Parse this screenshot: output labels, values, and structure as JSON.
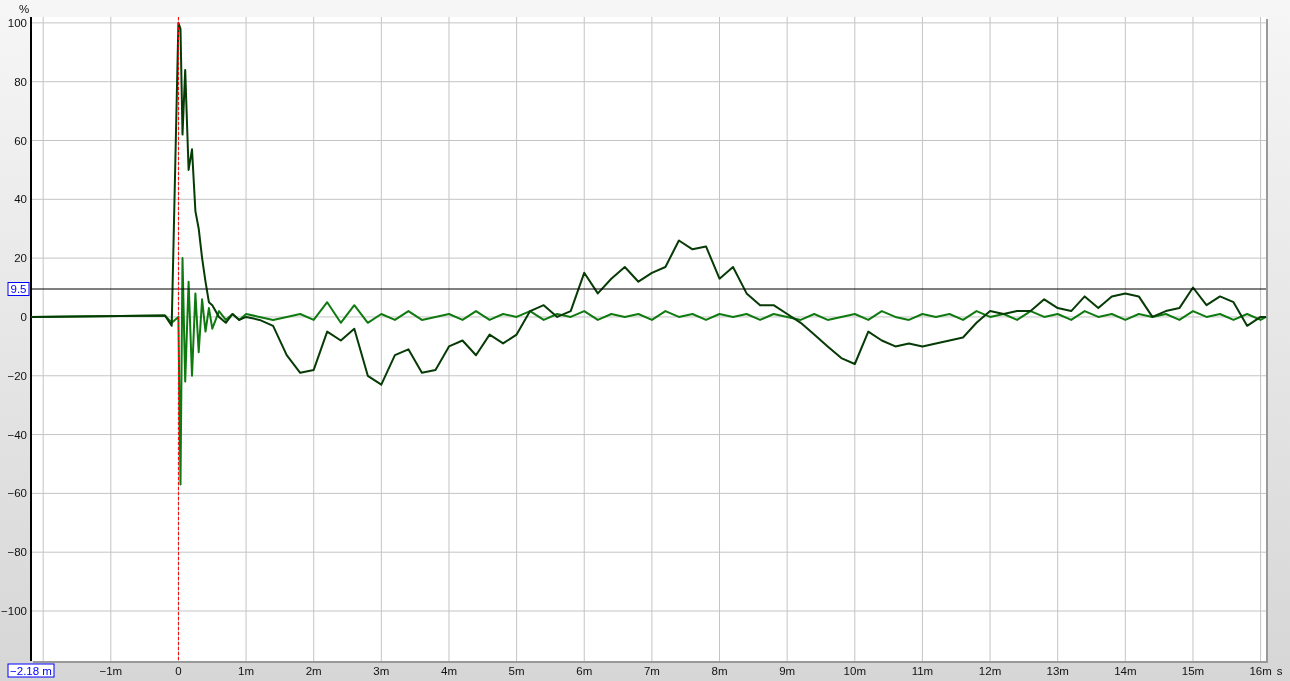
{
  "chart_data": {
    "type": "line",
    "ylabel": "%",
    "xlabel": "s",
    "xlim": [
      -2.18,
      16.08
    ],
    "ylim": [
      -117,
      102
    ],
    "yticks": [
      {
        "value": 100,
        "label": "100"
      },
      {
        "value": 80,
        "label": "80"
      },
      {
        "value": 60,
        "label": "60"
      },
      {
        "value": 40,
        "label": "40"
      },
      {
        "value": 20,
        "label": "20"
      },
      {
        "value": 0,
        "label": "0"
      },
      {
        "value": -20,
        "label": "−20"
      },
      {
        "value": -40,
        "label": "−40"
      },
      {
        "value": -60,
        "label": "−60"
      },
      {
        "value": -80,
        "label": "−80"
      },
      {
        "value": -100,
        "label": "−100"
      }
    ],
    "xticks": [
      {
        "value": -1,
        "label": "−1m"
      },
      {
        "value": 0,
        "label": "0"
      },
      {
        "value": 1,
        "label": "1m"
      },
      {
        "value": 2,
        "label": "2m"
      },
      {
        "value": 3,
        "label": "3m"
      },
      {
        "value": 4,
        "label": "4m"
      },
      {
        "value": 5,
        "label": "5m"
      },
      {
        "value": 6,
        "label": "6m"
      },
      {
        "value": 7,
        "label": "7m"
      },
      {
        "value": 8,
        "label": "8m"
      },
      {
        "value": 9,
        "label": "9m"
      },
      {
        "value": 10,
        "label": "10m"
      },
      {
        "value": 11,
        "label": "11m"
      },
      {
        "value": 12,
        "label": "12m"
      },
      {
        "value": 13,
        "label": "13m"
      },
      {
        "value": 14,
        "label": "14m"
      },
      {
        "value": 15,
        "label": "15m"
      },
      {
        "value": 16,
        "label": "16m"
      }
    ],
    "grid": true,
    "x": [
      -2.18,
      -0.2,
      -0.1,
      0,
      0.03,
      0.06,
      0.1,
      0.15,
      0.2,
      0.25,
      0.3,
      0.35,
      0.4,
      0.45,
      0.5,
      0.6,
      0.7,
      0.8,
      0.9,
      1.0,
      1.2,
      1.4,
      1.6,
      1.8,
      2.0,
      2.2,
      2.4,
      2.6,
      2.8,
      3.0,
      3.2,
      3.4,
      3.6,
      3.8,
      4.0,
      4.2,
      4.4,
      4.6,
      4.8,
      5.0,
      5.2,
      5.4,
      5.6,
      5.8,
      6.0,
      6.2,
      6.4,
      6.6,
      6.8,
      7.0,
      7.2,
      7.4,
      7.6,
      7.8,
      8.0,
      8.2,
      8.4,
      8.6,
      8.8,
      9.0,
      9.2,
      9.4,
      9.6,
      9.8,
      10.0,
      10.2,
      10.4,
      10.6,
      10.8,
      11.0,
      11.2,
      11.4,
      11.6,
      11.8,
      12.0,
      12.2,
      12.4,
      12.6,
      12.8,
      13.0,
      13.2,
      13.4,
      13.6,
      13.8,
      14.0,
      14.2,
      14.4,
      14.6,
      14.8,
      15.0,
      15.2,
      15.4,
      15.6,
      15.8,
      16.0,
      16.08
    ],
    "series": [
      {
        "color": "#0f7a0f",
        "values": [
          0,
          0.5,
          -2,
          0,
          -57,
          20,
          -22,
          12,
          -20,
          8,
          -12,
          6,
          -5,
          3,
          -4,
          2,
          -1,
          1,
          -1,
          1,
          0,
          -1,
          0,
          1,
          -1,
          5,
          -2,
          4,
          -2,
          1,
          -1,
          2,
          -1,
          0,
          1,
          -1,
          2,
          -1,
          1,
          0,
          2,
          -1,
          1,
          0,
          2,
          -1,
          1,
          0,
          1,
          -1,
          2,
          0,
          1,
          -1,
          1,
          0,
          1,
          -1,
          1,
          0,
          -1,
          1,
          -1,
          0,
          1,
          -1,
          2,
          0,
          -1,
          1,
          0,
          1,
          -1,
          2,
          0,
          1,
          -1,
          2,
          0,
          1,
          -1,
          2,
          0,
          1,
          -1,
          1,
          0,
          1,
          -1,
          2,
          0,
          1,
          -1,
          1,
          -1,
          0
        ]
      },
      {
        "color": "#063b06",
        "values": [
          0,
          0.5,
          -3,
          100,
          98,
          62,
          84,
          50,
          57,
          36,
          30,
          20,
          12,
          5,
          4,
          0,
          -2,
          1,
          -1,
          0,
          -1,
          -3,
          -13,
          -19,
          -18,
          -5,
          -8,
          -4,
          -20,
          -23,
          -13,
          -11,
          -19,
          -18,
          -10,
          -8,
          -13,
          -6,
          -9,
          -6,
          2,
          4,
          0,
          2,
          15,
          8,
          13,
          17,
          12,
          15,
          17,
          26,
          23,
          24,
          13,
          17,
          8,
          4,
          4,
          1,
          -2,
          -6,
          -10,
          -14,
          -16,
          -5,
          -8,
          -10,
          -9,
          -10,
          -9,
          -8,
          -7,
          -2,
          2,
          1,
          2,
          2,
          6,
          3,
          2,
          7,
          3,
          7,
          8,
          7,
          0,
          2,
          3,
          10,
          4,
          7,
          5,
          -3,
          0,
          0
        ]
      }
    ],
    "ref_lines": [
      {
        "axis": "y",
        "value": 9.5,
        "label": "9.5",
        "color": "#000000"
      },
      {
        "axis": "x",
        "value": 0,
        "color": "#ff0000"
      }
    ]
  },
  "cursor_readout": "−2.18 m"
}
